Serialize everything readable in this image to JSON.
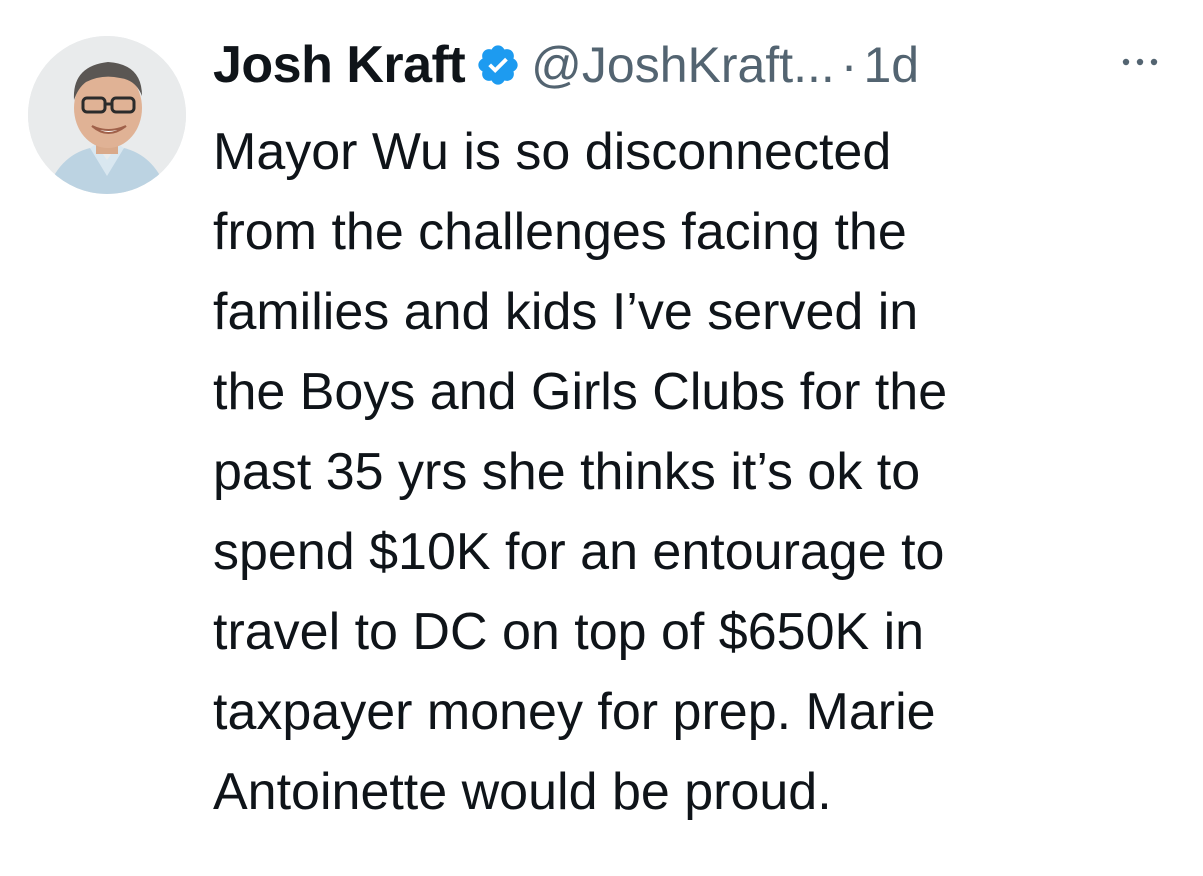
{
  "tweet": {
    "author_name": "Josh Kraft",
    "handle": "@JoshKraft...",
    "separator": "·",
    "time": "1d",
    "verified_icon": "verified-badge-icon",
    "more_icon": "more-options-icon",
    "text": "Mayor Wu is so disconnected\nfrom the challenges facing the\nfamilies and kids I’ve served in\nthe Boys and Girls Clubs for the\npast 35 yrs she thinks it’s ok to\nspend $10K for an entourage to\ntravel to DC on top of $650K in\ntaxpayer money for prep. Marie\nAntoinette would be proud."
  },
  "colors": {
    "text": "#0f1419",
    "secondary": "#536471",
    "verified": "#1d9bf0"
  }
}
